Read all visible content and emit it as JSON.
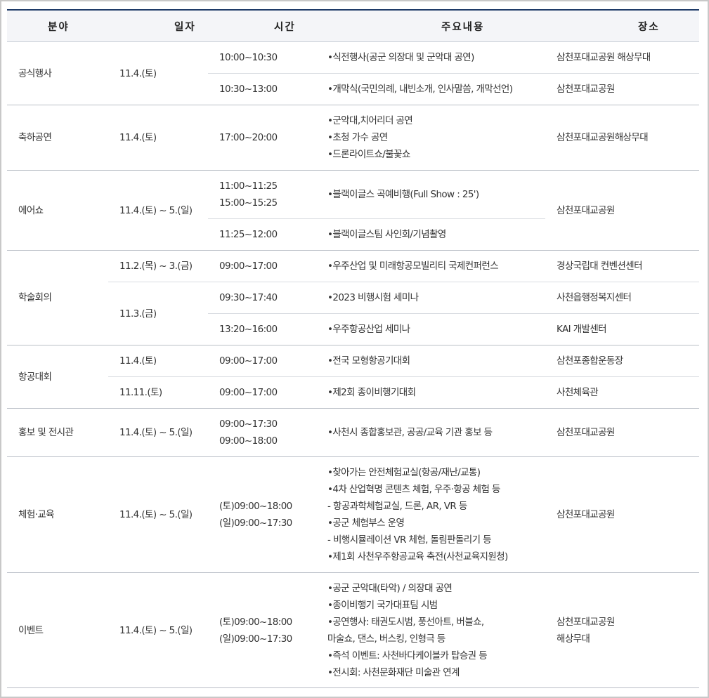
{
  "headers": {
    "category": "분야",
    "date": "일자",
    "time": "시간",
    "content": "주요내용",
    "place": "장소"
  },
  "rows": {
    "official": {
      "category": "공식행사",
      "date": "11.4.(토)",
      "r1": {
        "time": "10:00~10:30",
        "content": "•식전행사(공군 의장대 및 군악대 공연)",
        "place": "삼천포대교공원 해상무대"
      },
      "r2": {
        "time": "10:30~13:00",
        "content": "•개막식(국민의례, 내빈소개, 인사말씀, 개막선언)",
        "place": "삼천포대교공원"
      }
    },
    "celebration": {
      "category": "축하공연",
      "date": "11.4.(토)",
      "time": "17:00~20:00",
      "content": [
        "•군악대,치어리더 공연",
        "•초청 가수 공연",
        "•드론라이트쇼/불꽃쇼"
      ],
      "place": "삼천포대교공원해상무대"
    },
    "airshow": {
      "category": "에어쇼",
      "date": "11.4.(토) ~ 5.(일)",
      "place": "삼천포대교공원",
      "r1": {
        "time": [
          "11:00~11:25",
          "15:00~15:25"
        ],
        "content": "•블랙이글스 곡예비행(Full Show : 25')"
      },
      "r2": {
        "time": "11:25~12:00",
        "content": "•블랙이글스팀 사인회/기념촬영"
      }
    },
    "conference": {
      "category": "학술회의",
      "r1": {
        "date": "11.2.(목) ~ 3.(금)",
        "time": "09:00~17:00",
        "content": "•우주산업 및 미래항공모빌리티 국제컨퍼런스",
        "place": "경상국립대 컨벤션센터"
      },
      "date2": "11.3.(금)",
      "r2": {
        "time": "09:30~17:40",
        "content": "•2023 비행시험 세미나",
        "place": "사천읍행정복지센터"
      },
      "r3": {
        "time": "13:20~16:00",
        "content": "•우주항공산업 세미나",
        "place": "KAI 개발센터"
      }
    },
    "aviation": {
      "category": "항공대회",
      "r1": {
        "date": "11.4.(토)",
        "time": "09:00~17:00",
        "content": "•전국 모형항공기대회",
        "place": "삼천포종합운동장"
      },
      "r2": {
        "date": "11.11.(토)",
        "time": "09:00~17:00",
        "content": "•제2회 종이비행기대회",
        "place": "사천체육관"
      }
    },
    "promo": {
      "category": "홍보 및 전시관",
      "date": "11.4.(토) ~ 5.(일)",
      "time": [
        "09:00~17:30",
        "09:00~18:00"
      ],
      "content": "•사천시 종합홍보관, 공공/교육 기관 홍보 등",
      "place": "삼천포대교공원"
    },
    "experience": {
      "category": "체험·교육",
      "date": "11.4.(토) ~ 5.(일)",
      "time": [
        "(토)09:00~18:00",
        "(일)09:00~17:30"
      ],
      "content": [
        "•찾아가는 안전체험교실(항공/재난/교통)",
        "•4차 산업혁명 콘텐츠 체험, 우주·항공 체험 등",
        "- 항공과학체험교실, 드론, AR, VR 등",
        "•공군 체험부스 운영",
        "- 비행시뮬레이션 VR 체험, 돌림판돌리기 등",
        "•제1회 사천우주항공교육 축전(사천교육지원청)"
      ],
      "place": "삼천포대교공원"
    },
    "event": {
      "category": "이벤트",
      "date": "11.4.(토) ~ 5.(일)",
      "time": [
        "(토)09:00~18:00",
        "(일)09:00~17:30"
      ],
      "content": [
        "•공군 군악대(타악) / 의장대 공연",
        "•종이비행기 국가대표팀 시범",
        "•공연행사: 태권도시범, 풍선아트, 버블쇼,",
        "마술쇼, 댄스, 버스킹, 인형극 등",
        "•즉석 이벤트: 사천바다케이블카 탑승권 등",
        "•전시회: 사천문화재단 미술관 연계"
      ],
      "place": [
        "삼천포대교공원",
        "해상무대"
      ]
    }
  }
}
